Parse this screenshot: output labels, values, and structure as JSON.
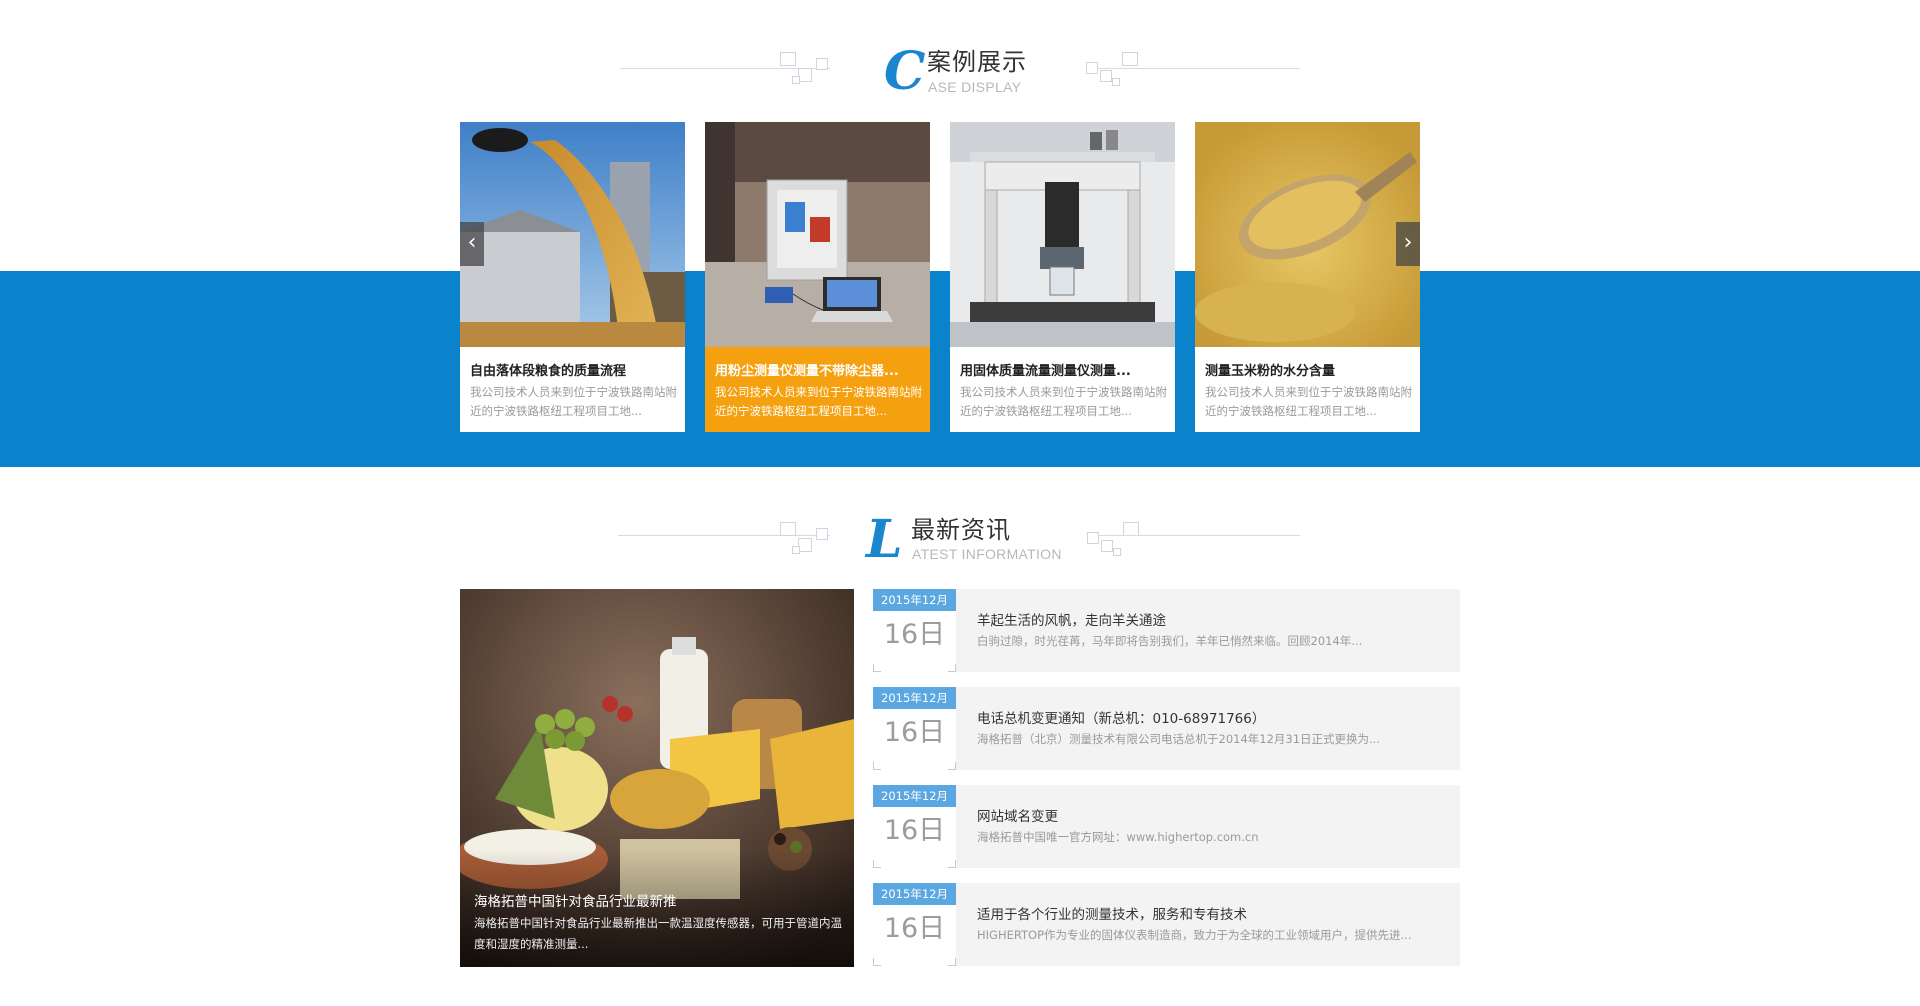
{
  "case_section": {
    "initial": "C",
    "title": "案例展示",
    "subtitle": "ASE DISPLAY",
    "prev_arrow": "‹",
    "next_arrow": "›",
    "cards": [
      {
        "title": "自由落体段粮食的质量流程",
        "desc": "我公司技术人员来到位于宁波铁路南站附近的宁波铁路枢纽工程项目工地...",
        "active": false
      },
      {
        "title": "用粉尘测量仪测量不带除尘器...",
        "desc": "我公司技术人员来到位于宁波铁路南站附近的宁波铁路枢纽工程项目工地...",
        "active": true
      },
      {
        "title": "用固体质量流量测量仪测量...",
        "desc": "我公司技术人员来到位于宁波铁路南站附近的宁波铁路枢纽工程项目工地...",
        "active": false
      },
      {
        "title": "测量玉米粉的水分含量",
        "desc": "我公司技术人员来到位于宁波铁路南站附近的宁波铁路枢纽工程项目工地...",
        "active": false
      }
    ]
  },
  "news_section": {
    "initial": "L",
    "title": "最新资讯",
    "subtitle": "ATEST INFORMATION",
    "feature": {
      "title": "海格拓普中国针对食品行业最新推",
      "desc": "海格拓普中国针对食品行业最新推出一款温湿度传感器，可用于管道内温度和湿度的精准测量..."
    },
    "items": [
      {
        "month": "2015年12月",
        "day": "16日",
        "title": "羊起生活的风帆，走向羊关通途",
        "desc": "白驹过隙，时光荏苒，马年即将告别我们，羊年已悄然来临。回顾2014年..."
      },
      {
        "month": "2015年12月",
        "day": "16日",
        "title": "电话总机变更通知（新总机：010-68971766）",
        "desc": "海格拓普（北京）测量技术有限公司电话总机于2014年12月31日正式更换为..."
      },
      {
        "month": "2015年12月",
        "day": "16日",
        "title": "网站域名变更",
        "desc": "海格拓普中国唯一官方网址：www.highertop.com.cn"
      },
      {
        "month": "2015年12月",
        "day": "16日",
        "title": "适用于各个行业的测量技术，服务和专有技术",
        "desc": "HIGHERTOP作为专业的固体仪表制造商，致力于为全球的工业领域用户，提供先进..."
      }
    ]
  },
  "colors": {
    "band": "#0b83cc",
    "active_card": "#f5a00e",
    "date_tab": "#5aa7e2",
    "accent_letter": "#1a86cf"
  }
}
